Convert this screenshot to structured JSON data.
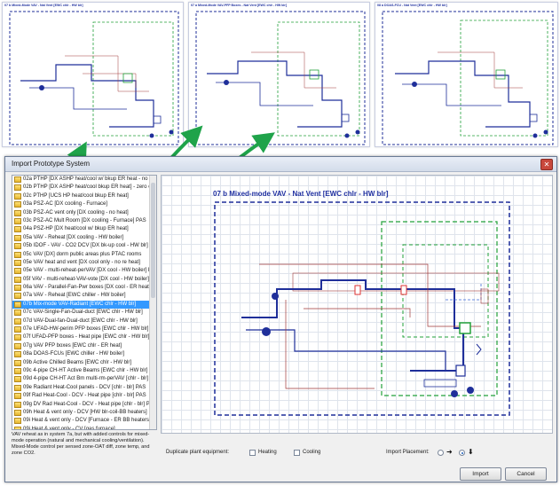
{
  "thumbnails": [
    {
      "title": "07 b Mixed-Mode VAV - Nat Vent [EWC chlr - HW blr]"
    },
    {
      "title": "07 a Mixed-Mode VAV-PFP Boxes - Nat Vent [EWC chlr - HW blr]"
    },
    {
      "title": "08 a DOAS-FCU - Nat Vent [EWC chlr - HW blr]"
    }
  ],
  "dialog": {
    "title": "Import Prototype System",
    "close_glyph": "✕"
  },
  "system_list": {
    "items": [
      "02a PTHP [DX ASHP heat/cool w/ bkup ER heat - no vent",
      "02b PTHP [DX ASHP heat/cool bkup ER heat] - zero or min",
      "02c PTHP [UCS HP heat/cool bkup ER heat]",
      "03a PSZ-AC [DX cooling - Furnace]",
      "03b PSZ-AC vent only [DX cooling - no heat]",
      "03c PSZ-AC Mult Room [DX cooling - Furnace] PAS",
      "04a PSZ-HP [DX heat/cool w/ bkup ER heat]",
      "05a VAV - Reheat [DX cooling - HW boiler]",
      "05b IDOF - VAV - CO2 DCV [DX bk-up cool - HW blr]",
      "05c VAV [DX] dorm public areas plus PTAC rooms",
      "05e VAV heat and vent [DX cool only - no re heat]",
      "05e VAV - multi-reheat-perVAV [DX cool - HW boiler] PAS",
      "05f VAV - multi-reheat-VAV-vote [DX cool - HW boiler] PAS",
      "06a VAV - Parallel-Fan-Pwr boxes [DX cool - ER heat]",
      "07a VAV - Reheat [EWC chiller - HW boiler]",
      "07b Mix-mode VAV-Radiant [EWC chlr - HW blr]",
      "07c VAV-Single-Fan-Dual-duct [EWC chlr - HW blr]",
      "07d VAV-Dual-fan-Dual-duct [EWC chlr - HW blr]",
      "07e UFAD-HW-perim PFP boxes [EWC chlr - HW blr]",
      "07f UFAD-PFP boxes - Heat pipe [EWC chlr - HW blr]",
      "07g VAV PFP boxes [EWC chlr - ER heat]",
      "08a DOAS-FCUs [EWC chiller - HW boiler]",
      "09b Active Chilled Beams [EWC chlr - HW blr]",
      "09c 4-pipe CH-HT Active Beams [EWC chlr - HW blr]",
      "09d 4-pipe CH-HT Act Bm multi-rm-perVAV [chlr - blr] PAS",
      "09e Radiant Heat-Cool panels - DCV [chlr - blr] PAS",
      "09f Rad Heat-Cool - DCV - Heat pipe [chlr - blr] PAS",
      "09g DV Rad Heat-Cool - DCV - Heat pipe [chlr - blr] PAS",
      "09h Heat & vent only - DCV [HW blr-coil-BB heaters]",
      "09i Heat & vent only - DCV [Furnace - ER BB heaters]",
      "09j Heat & vent only - CV [gas furnace]",
      "09k Heat & vent only - CV [electric resistance coil only]",
      "10a Parking garage - fan only NAS",
      "99x Plant, Equipment, & Profiles only",
      "IDDE + VAV"
    ],
    "selected_index": 15
  },
  "description": "VAV reheat as in system 7a, but with added controls for mixed-mode operation (natural and mechanical cooling/ventilation). Mixed-Mode control per sensed zone-OAT diff, zone temp, and zone CO2.",
  "preview": {
    "title": "07 b Mixed-mode VAV - Nat Vent [EWC chlr - HW blr]"
  },
  "options": {
    "duplicate_label": "Duplicate plant equipment:",
    "heating_label": "Heating",
    "cooling_label": "Cooling",
    "placement_label": "Import Placement:",
    "placement_right_icon": "arrow-right-icon",
    "placement_down_icon": "arrow-down-icon",
    "placement_selected": "down"
  },
  "buttons": {
    "import_label": "Import",
    "cancel_label": "Cancel"
  },
  "colors": {
    "frame_blue": "#1f2f9a",
    "loop_green": "#22a03a",
    "selection_blue": "#3399ff",
    "arrow_green": "#1fa34a"
  }
}
